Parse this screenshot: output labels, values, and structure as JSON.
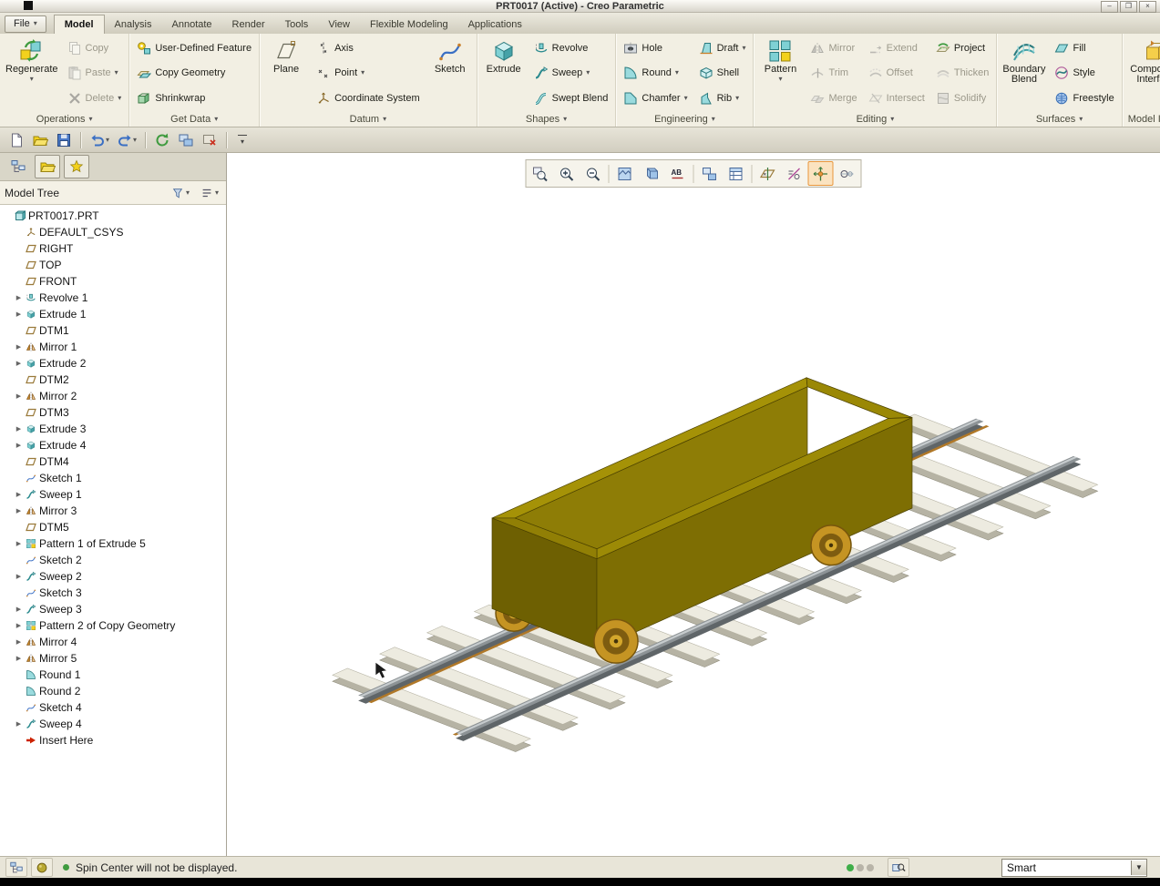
{
  "window": {
    "title": "PRT0017 (Active) - Creo Parametric",
    "controls": [
      {
        "name": "minimize",
        "glyph": "–"
      },
      {
        "name": "restore",
        "glyph": "❐"
      },
      {
        "name": "close",
        "glyph": "×"
      }
    ]
  },
  "tabs": {
    "file": "File",
    "items": [
      {
        "label": "Model",
        "active": true
      },
      {
        "label": "Analysis"
      },
      {
        "label": "Annotate"
      },
      {
        "label": "Render"
      },
      {
        "label": "Tools"
      },
      {
        "label": "View"
      },
      {
        "label": "Flexible Modeling"
      },
      {
        "label": "Applications"
      }
    ]
  },
  "ribbon": {
    "groups": [
      {
        "label": "Operations",
        "items": [
          {
            "type": "large",
            "label": "Regenerate",
            "icon": "regenerate",
            "dropdown": true
          },
          {
            "type": "column",
            "buttons": [
              {
                "label": "Copy",
                "icon": "copy",
                "disabled": true
              },
              {
                "label": "Paste",
                "icon": "paste",
                "dropdown": true,
                "disabled": true
              },
              {
                "label": "Delete",
                "icon": "delete",
                "dropdown": true,
                "disabled": true
              }
            ]
          }
        ]
      },
      {
        "label": "Get Data",
        "items": [
          {
            "type": "column",
            "buttons": [
              {
                "label": "User-Defined Feature",
                "icon": "udf"
              },
              {
                "label": "Copy Geometry",
                "icon": "copy-geometry"
              },
              {
                "label": "Shrinkwrap",
                "icon": "shrinkwrap"
              }
            ]
          }
        ]
      },
      {
        "label": "Datum",
        "items": [
          {
            "type": "large",
            "label": "Plane",
            "icon": "plane"
          },
          {
            "type": "column",
            "buttons": [
              {
                "label": "Axis",
                "icon": "axis"
              },
              {
                "label": "Point",
                "icon": "point",
                "dropdown": true
              },
              {
                "label": "Coordinate System",
                "icon": "csys"
              }
            ]
          },
          {
            "type": "large",
            "label": "Sketch",
            "icon": "sketch"
          }
        ]
      },
      {
        "label": "Shapes",
        "items": [
          {
            "type": "large",
            "label": "Extrude",
            "icon": "extrude"
          },
          {
            "type": "column",
            "buttons": [
              {
                "label": "Revolve",
                "icon": "revolve"
              },
              {
                "label": "Sweep",
                "icon": "sweep",
                "dropdown": true
              },
              {
                "label": "Swept Blend",
                "icon": "swept-blend"
              }
            ]
          }
        ]
      },
      {
        "label": "Engineering",
        "items": [
          {
            "type": "column",
            "buttons": [
              {
                "label": "Hole",
                "icon": "hole"
              },
              {
                "label": "Round",
                "icon": "round",
                "dropdown": true
              },
              {
                "label": "Chamfer",
                "icon": "chamfer",
                "dropdown": true
              }
            ]
          },
          {
            "type": "column",
            "buttons": [
              {
                "label": "Draft",
                "icon": "draft",
                "dropdown": true
              },
              {
                "label": "Shell",
                "icon": "shell"
              },
              {
                "label": "Rib",
                "icon": "rib",
                "dropdown": true
              }
            ]
          }
        ]
      },
      {
        "label": "Editing",
        "items": [
          {
            "type": "large",
            "label": "Pattern",
            "icon": "pattern",
            "dropdown": true
          },
          {
            "type": "column",
            "buttons": [
              {
                "label": "Mirror",
                "icon": "mirror",
                "disabled": true
              },
              {
                "label": "Trim",
                "icon": "trim",
                "disabled": true
              },
              {
                "label": "Merge",
                "icon": "merge",
                "disabled": true
              }
            ]
          },
          {
            "type": "column",
            "buttons": [
              {
                "label": "Extend",
                "icon": "extend",
                "disabled": true
              },
              {
                "label": "Offset",
                "icon": "offset",
                "disabled": true
              },
              {
                "label": "Intersect",
                "icon": "intersect",
                "disabled": true
              }
            ]
          },
          {
            "type": "column",
            "buttons": [
              {
                "label": "Project",
                "icon": "project"
              },
              {
                "label": "Thicken",
                "icon": "thicken",
                "disabled": true
              },
              {
                "label": "Solidify",
                "icon": "solidify",
                "disabled": true
              }
            ]
          }
        ]
      },
      {
        "label": "Surfaces",
        "items": [
          {
            "type": "large",
            "label": "Boundary Blend",
            "icon": "boundary-blend"
          },
          {
            "type": "column",
            "buttons": [
              {
                "label": "Fill",
                "icon": "fill"
              },
              {
                "label": "Style",
                "icon": "style"
              },
              {
                "label": "Freestyle",
                "icon": "freestyle"
              }
            ]
          }
        ]
      },
      {
        "label": "Model Intent",
        "items": [
          {
            "type": "large",
            "label": "Component Interface",
            "icon": "component-interface"
          }
        ]
      }
    ]
  },
  "quick_toolbar": {
    "buttons": [
      {
        "name": "new-file",
        "icon": "new"
      },
      {
        "name": "open-file",
        "icon": "open"
      },
      {
        "name": "save",
        "icon": "save"
      },
      {
        "name": "undo",
        "icon": "undo",
        "dropdown": true
      },
      {
        "name": "redo",
        "icon": "redo",
        "dropdown": true
      },
      {
        "name": "regenerate",
        "icon": "regen-small"
      },
      {
        "name": "windows",
        "icon": "windows"
      },
      {
        "name": "close-window",
        "icon": "close-window"
      }
    ],
    "sep_after": [
      2,
      4,
      7
    ]
  },
  "graphics_toolbar": {
    "buttons": [
      {
        "name": "refit"
      },
      {
        "name": "zoom-in"
      },
      {
        "name": "zoom-out"
      },
      {
        "name": "repaint"
      },
      {
        "name": "display-style"
      },
      {
        "name": "annotation-display"
      },
      {
        "name": "saved-orientations"
      },
      {
        "name": "view-manager"
      },
      {
        "name": "datum-display"
      },
      {
        "name": "annotation-filters"
      },
      {
        "name": "spin-center",
        "pressed": true
      },
      {
        "name": "perspective"
      }
    ],
    "sep_after": [
      2,
      5,
      7
    ]
  },
  "tree_panel": {
    "toolbar": [
      {
        "name": "show-model-tree",
        "icon": "tree-view",
        "boxed": false
      },
      {
        "name": "show-folder-browser",
        "icon": "open",
        "boxed": true
      },
      {
        "name": "show-favorites",
        "icon": "favorites",
        "boxed": true
      }
    ],
    "header": {
      "title": "Model Tree",
      "buttons": [
        {
          "name": "tree-filters",
          "icon": "filter"
        },
        {
          "name": "tree-columns",
          "icon": "list"
        }
      ]
    },
    "items": [
      {
        "label": "PRT0017.PRT",
        "icon": "part",
        "root": true
      },
      {
        "label": "DEFAULT_CSYS",
        "icon": "csys"
      },
      {
        "label": "RIGHT",
        "icon": "datum-plane"
      },
      {
        "label": "TOP",
        "icon": "datum-plane"
      },
      {
        "label": "FRONT",
        "icon": "datum-plane"
      },
      {
        "label": "Revolve 1",
        "icon": "revolve",
        "expandable": true
      },
      {
        "label": "Extrude 1",
        "icon": "extrude",
        "expandable": true
      },
      {
        "label": "DTM1",
        "icon": "datum-plane"
      },
      {
        "label": "Mirror 1",
        "icon": "mirror",
        "expandable": true
      },
      {
        "label": "Extrude 2",
        "icon": "extrude",
        "expandable": true
      },
      {
        "label": "DTM2",
        "icon": "datum-plane"
      },
      {
        "label": "Mirror 2",
        "icon": "mirror",
        "expandable": true
      },
      {
        "label": "DTM3",
        "icon": "datum-plane"
      },
      {
        "label": "Extrude 3",
        "icon": "extrude",
        "expandable": true
      },
      {
        "label": "Extrude 4",
        "icon": "extrude",
        "expandable": true
      },
      {
        "label": "DTM4",
        "icon": "datum-plane"
      },
      {
        "label": "Sketch 1",
        "icon": "sketch"
      },
      {
        "label": "Sweep 1",
        "icon": "sweep",
        "expandable": true
      },
      {
        "label": "Mirror 3",
        "icon": "mirror",
        "expandable": true
      },
      {
        "label": "DTM5",
        "icon": "datum-plane"
      },
      {
        "label": "Pattern 1 of Extrude 5",
        "icon": "pattern",
        "expandable": true
      },
      {
        "label": "Sketch 2",
        "icon": "sketch"
      },
      {
        "label": "Sweep 2",
        "icon": "sweep",
        "expandable": true
      },
      {
        "label": "Sketch 3",
        "icon": "sketch"
      },
      {
        "label": "Sweep 3",
        "icon": "sweep",
        "expandable": true
      },
      {
        "label": "Pattern 2 of Copy Geometry",
        "icon": "pattern",
        "expandable": true
      },
      {
        "label": "Mirror 4",
        "icon": "mirror",
        "expandable": true
      },
      {
        "label": "Mirror 5",
        "icon": "mirror",
        "expandable": true
      },
      {
        "label": "Round 1",
        "icon": "round"
      },
      {
        "label": "Round 2",
        "icon": "round"
      },
      {
        "label": "Sketch 4",
        "icon": "sketch"
      },
      {
        "label": "Sweep 4",
        "icon": "sweep",
        "expandable": true
      },
      {
        "label": "Insert Here",
        "icon": "insert"
      }
    ]
  },
  "viewport": {
    "model_shown": "mine cart on railway track",
    "colors": {
      "background": "#ffffff",
      "cart_body": "#7e6e03",
      "cart_end": "#6e6002",
      "cart_rim": "#a59207",
      "cart_inner_wall": "#8e7d06",
      "cart_inner_end": "#554a02",
      "cart_floor": "#6a5d02",
      "wheel_gold": "#c59423",
      "rail": "#8d9396",
      "rail_highlight": "#c7ccce",
      "tie_top": "#edebe0",
      "tie_side": "#b6b3a4",
      "track_base": "#b07828"
    }
  },
  "status_bar": {
    "left_buttons": [
      {
        "name": "model-tree-toggle",
        "icon": "tree-view"
      },
      {
        "name": "browser-toggle",
        "icon": "notification"
      }
    ],
    "bullet_color": "#3f9b3f",
    "message": "Spin Center will not be displayed.",
    "lights": [
      "#3fae49",
      "#b8b4a8",
      "#b8b4a8"
    ],
    "find_button": {
      "name": "find-in-model",
      "icon": "find"
    },
    "selection_filter": {
      "label": "Smart"
    }
  }
}
